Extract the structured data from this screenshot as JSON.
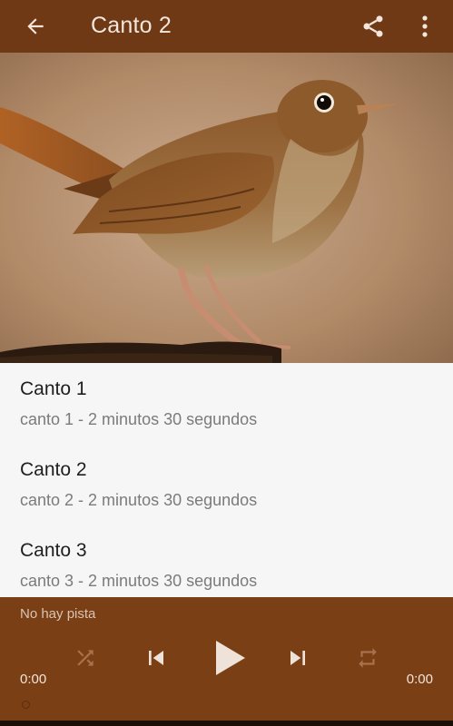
{
  "toolbar": {
    "title": "Canto 2",
    "back_icon": "arrow-back-icon",
    "share_icon": "share-icon",
    "menu_icon": "more-vert-icon"
  },
  "hero": {
    "image": "bird-photo"
  },
  "tracks": [
    {
      "name": "Canto 1",
      "subtitle": "canto 1 - 2 minutos 30 segundos"
    },
    {
      "name": "Canto 2",
      "subtitle": "canto 2 - 2 minutos 30 segundos"
    },
    {
      "name": "Canto 3",
      "subtitle": "canto 3 - 2 minutos 30 segundos"
    }
  ],
  "player": {
    "track_label": "No hay pista",
    "elapsed": "0:00",
    "duration": "0:00",
    "progress": 0,
    "controls": [
      "shuffle-icon",
      "skip-previous-icon",
      "play-icon",
      "skip-next-icon",
      "repeat-icon"
    ]
  },
  "colors": {
    "toolbar": "#6e3914",
    "player": "#7a3f15",
    "list_bg": "#f6f6f6"
  }
}
